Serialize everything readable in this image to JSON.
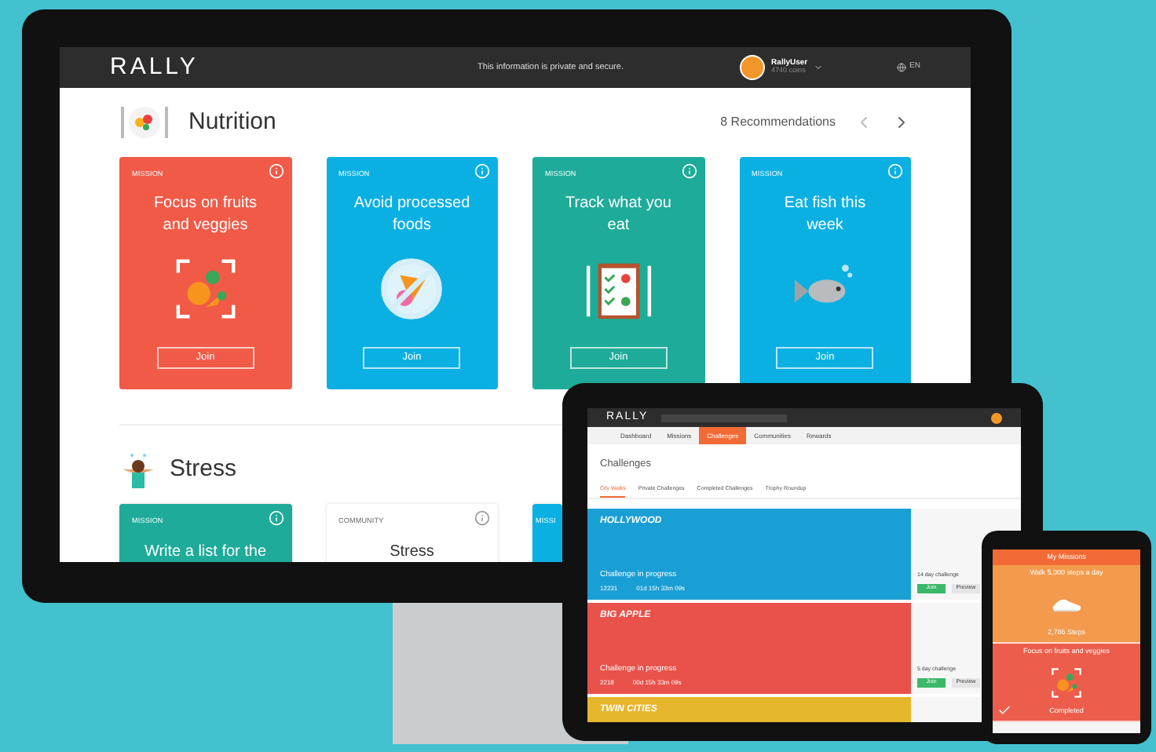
{
  "monitor": {
    "header": {
      "logo": "RALLY",
      "privacy": "This information is private and secure.",
      "user": "RallyUser",
      "coins": "4740 coins",
      "language": "EN"
    },
    "nutrition": {
      "title": "Nutrition",
      "count": "8 Recommendations",
      "cards": [
        {
          "label": "MISSION",
          "title": "Focus on fruits and veggies",
          "color": "#f05a47",
          "kind": "veggies",
          "button": "Join"
        },
        {
          "label": "MISSION",
          "title": "Avoid processed foods",
          "color": "#0bb0e3",
          "kind": "no-food",
          "button": "Join"
        },
        {
          "label": "MISSION",
          "title": "Track what you eat",
          "color": "#1eab99",
          "kind": "clipboard",
          "button": "Join"
        },
        {
          "label": "MISSION",
          "title": "Eat fish this week",
          "color": "#0bb0e3",
          "kind": "fish",
          "button": "Join"
        }
      ]
    },
    "stress": {
      "title": "Stress",
      "cards": [
        {
          "label": "MISSION",
          "title": "Write a list for the",
          "color": "#1eab99"
        },
        {
          "label": "COMMUNITY",
          "title": "Stress",
          "color": "#ffffff"
        },
        {
          "label": "MISSI",
          "color": "#0bb0e3"
        }
      ]
    }
  },
  "tablet": {
    "logo": "RALLY",
    "nav": [
      {
        "label": "Dashboard",
        "selected": false
      },
      {
        "label": "Missions",
        "selected": false
      },
      {
        "label": "Challenges",
        "selected": true
      },
      {
        "label": "Communities",
        "selected": false
      },
      {
        "label": "Rewards",
        "selected": false
      }
    ],
    "title": "Challenges",
    "subtabs": [
      {
        "label": "City Walks",
        "selected": true
      },
      {
        "label": "Private Challenges",
        "selected": false
      },
      {
        "label": "Completed Challenges",
        "selected": false
      },
      {
        "label": "Trophy Roundup",
        "selected": false
      }
    ],
    "challenges": [
      {
        "name": "HOLLYWOOD",
        "color": "#1a9fd4",
        "status": "Challenge in progress",
        "participants": "12231",
        "remaining": "01d 15h 33m 09s",
        "length": "14 day challenge",
        "join": "Join",
        "preview": "Preview"
      },
      {
        "name": "BIG APPLE",
        "color": "#e8524a",
        "status": "Challenge in progress",
        "participants": "2218",
        "remaining": "00d 15h 33m 09s",
        "length": "5 day challenge",
        "join": "Join",
        "preview": "Preview"
      },
      {
        "name": "TWIN CITIES",
        "color": "#e6b62c"
      }
    ]
  },
  "phone": {
    "title": "My Missions",
    "missions": [
      {
        "title": "Walk 5,000 steps a day",
        "color": "#f39a4c",
        "kind": "shoe",
        "reading": "2,786 Steps"
      },
      {
        "title": "Focus on fruits and veggies",
        "color": "#ec5e4b",
        "kind": "veggies",
        "reading": "Completed"
      }
    ]
  }
}
